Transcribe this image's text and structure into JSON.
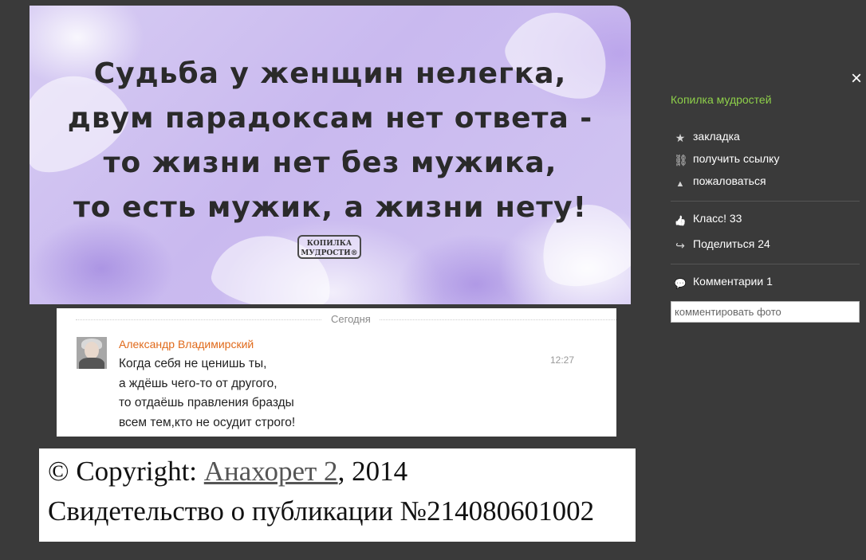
{
  "photo": {
    "quote_lines": [
      "Судьба у женщин нелегка,",
      "двум парадоксам нет ответа -",
      "то жизни нет без мужика,",
      "то есть мужик, а жизни нету!"
    ],
    "stamp_line1": "КОПИЛКА",
    "stamp_line2": "МУДРОСТИ®"
  },
  "comments": {
    "date_label": "Сегодня",
    "items": [
      {
        "author": "Александр Владимирский",
        "text": "Когда себя не ценишь ты,\nа ждёшь чего-то от другого,\nто отдаёшь правления бразды\nвсем тем,кто не осудит строго!",
        "time": "12:27"
      }
    ]
  },
  "copyright": {
    "prefix": "© Copyright: ",
    "author_link": "Анахорет 2",
    "suffix": ", 2014",
    "certificate": "Свидетельство о публикации №214080601002"
  },
  "sidebar": {
    "close_icon": "×",
    "album_name": "Копилка мудростей",
    "actions": [
      {
        "icon": "star-icon",
        "glyph": "★",
        "label": "закладка"
      },
      {
        "icon": "link-icon",
        "glyph": "⛓",
        "label": "получить ссылку"
      },
      {
        "icon": "warning-icon",
        "glyph": "▲",
        "label": "пожаловаться"
      }
    ],
    "klass": {
      "icon": "thumbs-up-icon",
      "glyph": "👍",
      "label": "Класс! 33"
    },
    "share": {
      "icon": "share-arrow-icon",
      "glyph": "↪",
      "label": "Поделиться 24"
    },
    "comments_count": {
      "icon": "speech-bubble-icon",
      "glyph": "💬",
      "label": "Комментарии 1"
    },
    "comment_placeholder": "комментировать фото"
  }
}
